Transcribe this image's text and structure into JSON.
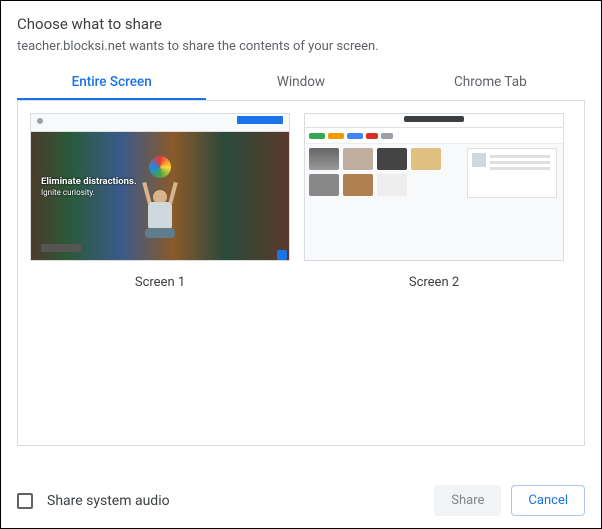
{
  "dialog": {
    "title": "Choose what to share",
    "subtitle": "teacher.blocksi.net wants to share the contents of your screen."
  },
  "tabs": {
    "entire_screen": "Entire Screen",
    "window": "Window",
    "chrome_tab": "Chrome Tab",
    "active_index": 0
  },
  "options": {
    "screen1": {
      "label": "Screen 1"
    },
    "screen2": {
      "label": "Screen 2"
    }
  },
  "thumb1_overlay": {
    "headline": "Eliminate distractions.",
    "subline": "Ignite curiosity."
  },
  "footer": {
    "share_audio_label": "Share system audio",
    "share_audio_checked": false,
    "share_button": "Share",
    "cancel_button": "Cancel"
  }
}
